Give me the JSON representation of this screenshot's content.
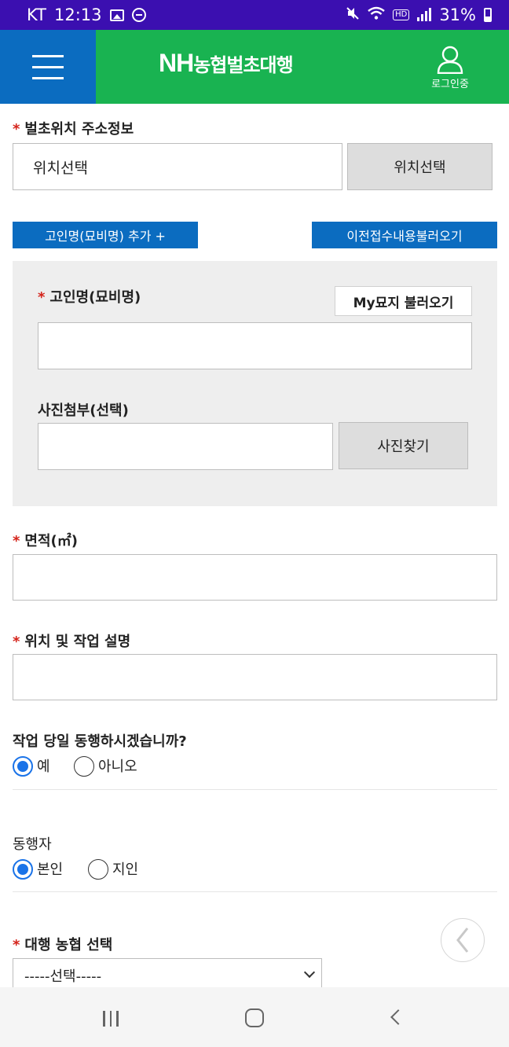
{
  "status_bar": {
    "carrier": "KT",
    "time": "12:13",
    "battery": "31%",
    "hd_badge": "HD",
    "icons": [
      "image-icon",
      "dnd-icon",
      "mute-icon",
      "wifi-icon",
      "hd-icon",
      "signal-icon",
      "battery-icon"
    ]
  },
  "header": {
    "brand_logo": "NH",
    "brand_name": "농협벌초대행",
    "login_label": "로그인중",
    "colors": {
      "green": "#19b351",
      "blue": "#0b6cc0"
    }
  },
  "form": {
    "location": {
      "label": "벌초위치 주소정보",
      "value": "위치선택",
      "button": "위치선택"
    },
    "add_deceased_button": "고인명(묘비명) 추가 +",
    "load_previous_button": "이전접수내용불러오기",
    "deceased": {
      "label": "고인명(묘비명)",
      "my_grave_button": "My묘지 불러오기",
      "value": ""
    },
    "photo": {
      "label": "사진첨부(선택)",
      "value": "",
      "button": "사진찾기"
    },
    "area": {
      "label": "면적(㎡)",
      "value": ""
    },
    "description": {
      "label": "위치 및 작업 설명",
      "value": ""
    },
    "accompany": {
      "question": "작업 당일 동행하시겠습니까?",
      "options": [
        "예",
        "아니오"
      ],
      "selected": "예"
    },
    "companion": {
      "label": "동행자",
      "options": [
        "본인",
        "지인"
      ],
      "selected": "본인"
    },
    "agency": {
      "label": "대행 농협 선택",
      "selected": "-----선택-----"
    },
    "required_mark": "*"
  }
}
